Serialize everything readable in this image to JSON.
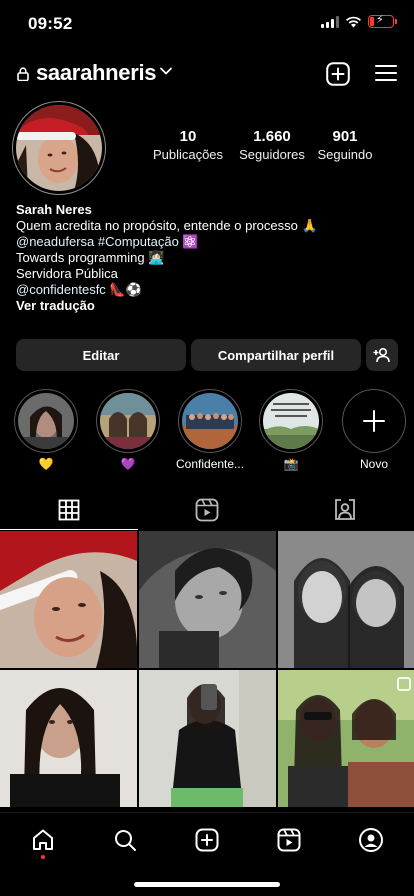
{
  "status": {
    "time": "09:52"
  },
  "header": {
    "username": "saarahneris"
  },
  "stats": {
    "posts": {
      "value": "10",
      "label": "Publicações"
    },
    "followers": {
      "value": "1.660",
      "label": "Seguidores"
    },
    "following": {
      "value": "901",
      "label": "Seguindo"
    }
  },
  "bio": {
    "name": "Sarah Neres",
    "line1": "Quem acredita no propósito, entende o processo 🙏",
    "line2": "@neadufersa #Computação ⚛️",
    "line3": "Towards programming 👩🏻‍💻",
    "line4": "Servidora Pública",
    "line5": "@confidentesfc 👠⚽",
    "translate": "Ver tradução"
  },
  "buttons": {
    "edit": "Editar",
    "share": "Compartilhar perfil"
  },
  "highlights": [
    {
      "label": "💛"
    },
    {
      "label": "💜"
    },
    {
      "label": "Confidente..."
    },
    {
      "label": "📸"
    },
    {
      "label": "Novo"
    }
  ],
  "colors": {
    "accent_red": "#ff3040",
    "button_bg": "#262626",
    "battery": "#ff3b30"
  }
}
